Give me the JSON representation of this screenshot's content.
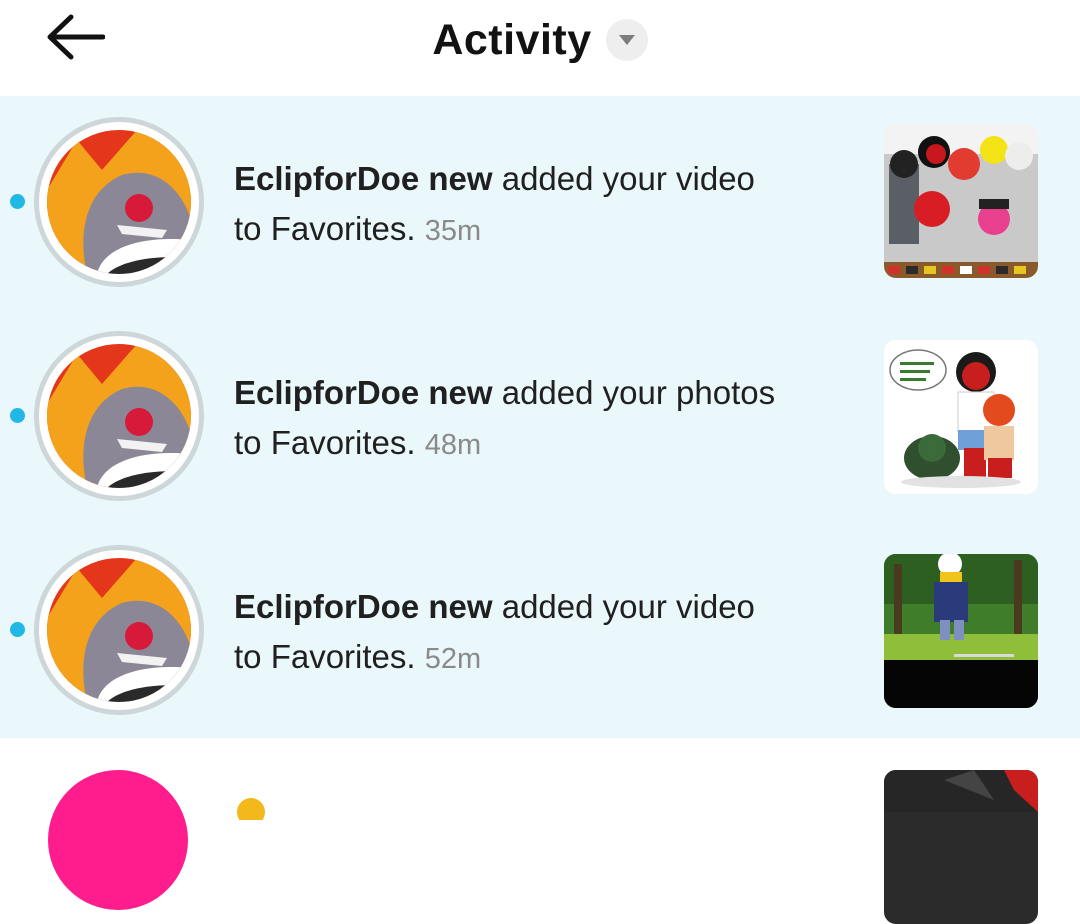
{
  "header": {
    "title": "Activity",
    "back_icon": "arrow-left-icon",
    "dropdown_icon": "caret-down-icon"
  },
  "colors": {
    "unread_background": "#eaf8fc",
    "unread_dot": "#22b8e6",
    "time_text": "#8a8a8a"
  },
  "notifications": [
    {
      "user": "EclipforDoe new",
      "action": "added your video",
      "object": "to Favorites.",
      "time": "35m",
      "unread": true
    },
    {
      "user": "EclipforDoe new",
      "action": "added your photos",
      "object": "to Favorites.",
      "time": "48m",
      "unread": true
    },
    {
      "user": "EclipforDoe new",
      "action": "added your video",
      "object": "to Favorites.",
      "time": "52m",
      "unread": true
    }
  ]
}
